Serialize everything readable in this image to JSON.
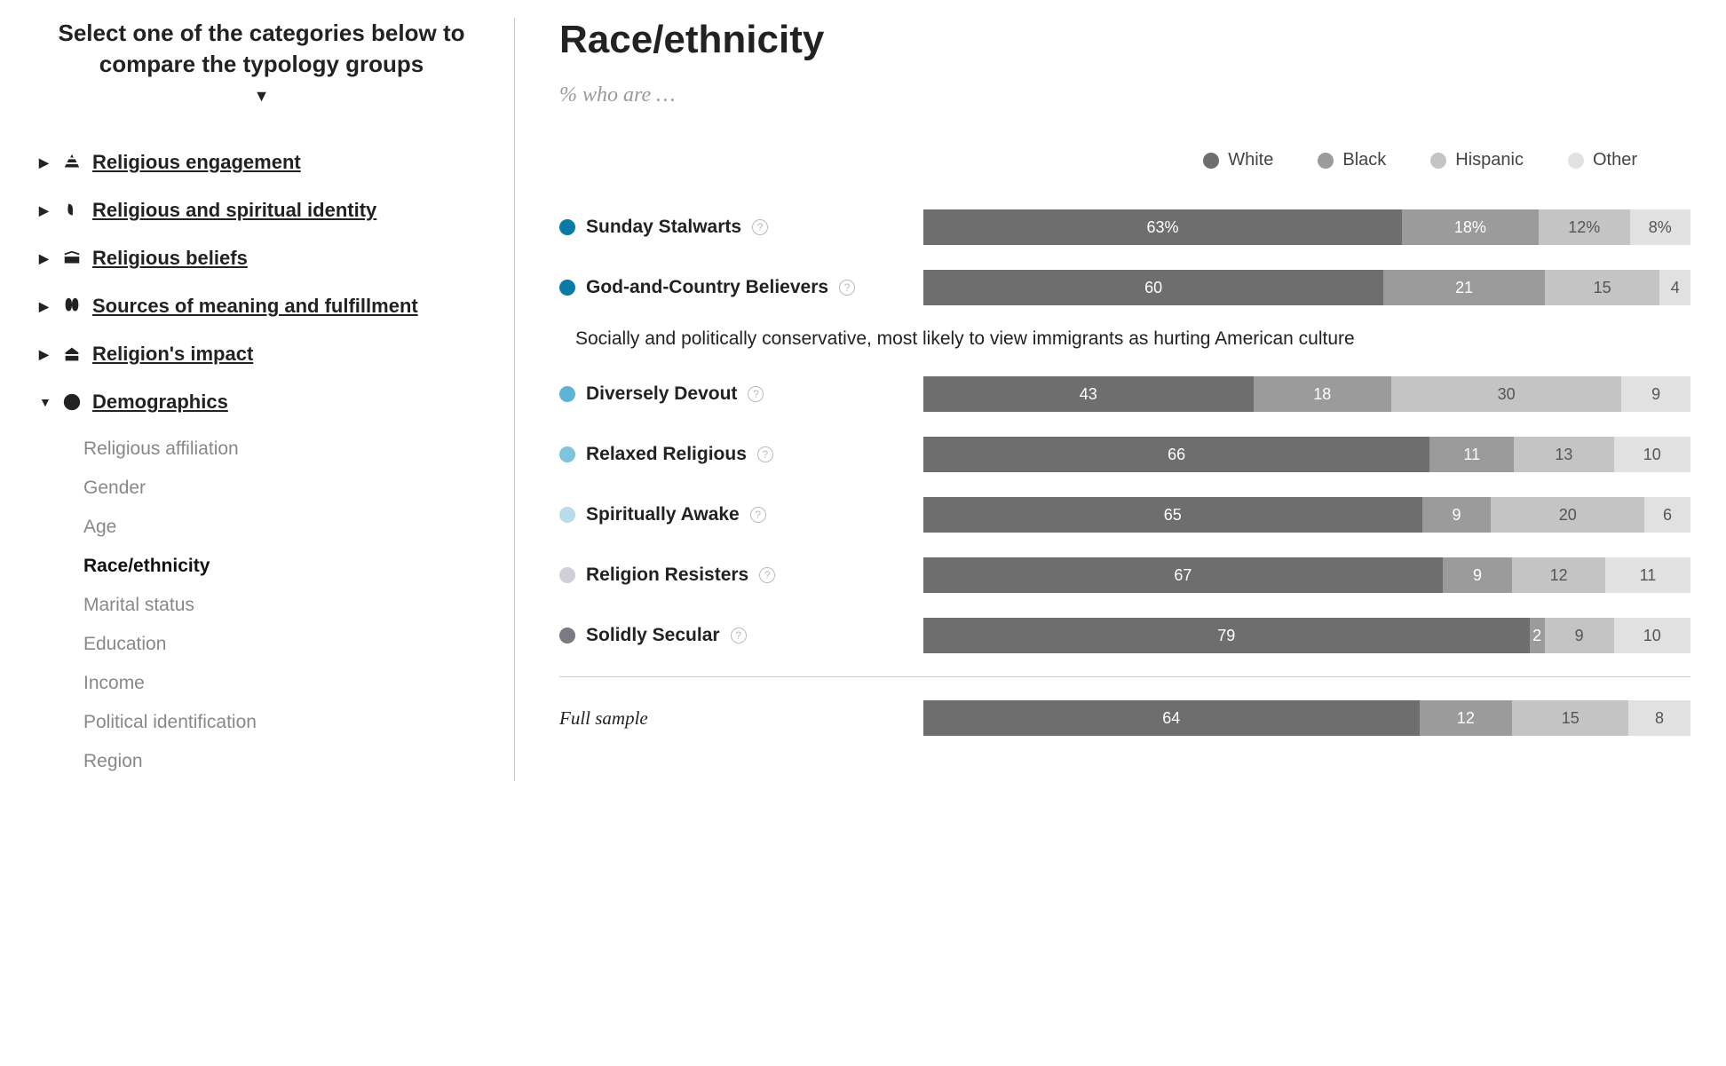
{
  "sidebar": {
    "header": "Select one of the categories below to compare the typology groups",
    "items": [
      {
        "label": "Religious engagement",
        "expanded": false
      },
      {
        "label": "Religious and spiritual identity",
        "expanded": false
      },
      {
        "label": "Religious beliefs",
        "expanded": false
      },
      {
        "label": "Sources of meaning and fulfillment",
        "expanded": false
      },
      {
        "label": "Religion's impact",
        "expanded": false
      },
      {
        "label": "Demographics",
        "expanded": true
      }
    ],
    "sub": [
      "Religious affiliation",
      "Gender",
      "Age",
      "Race/ethnicity",
      "Marital status",
      "Education",
      "Income",
      "Political identification",
      "Region"
    ],
    "sub_active": "Race/ethnicity"
  },
  "main": {
    "title": "Race/ethnicity",
    "subtitle": "% who are …",
    "tooltip": "Socially and politically conservative, most likely to view immigrants as hurting American culture",
    "full_sample_label": "Full sample"
  },
  "legend": [
    {
      "label": "White",
      "color": "#6e6e6e"
    },
    {
      "label": "Black",
      "color": "#9b9b9b"
    },
    {
      "label": "Hispanic",
      "color": "#c4c4c4"
    },
    {
      "label": "Other",
      "color": "#e1e1e1"
    }
  ],
  "groups": [
    {
      "name": "Sunday Stalwarts",
      "dot": "#0a7aa6"
    },
    {
      "name": "God-and-Country Believers",
      "dot": "#0a7aa6"
    },
    {
      "name": "Diversely Devout",
      "dot": "#5db4d4"
    },
    {
      "name": "Relaxed Religious",
      "dot": "#7fc4df"
    },
    {
      "name": "Spiritually Awake",
      "dot": "#b8dcea"
    },
    {
      "name": "Religion Resisters",
      "dot": "#cfcfd6"
    },
    {
      "name": "Solidly Secular",
      "dot": "#7a7a85"
    }
  ],
  "chart_data": {
    "type": "bar",
    "title": "Race/ethnicity",
    "subtitle": "% who are …",
    "xlabel": "",
    "ylabel": "",
    "stacked": true,
    "orientation": "horizontal",
    "unit": "%",
    "categories": [
      "Sunday Stalwarts",
      "God-and-Country Believers",
      "Diversely Devout",
      "Relaxed Religious",
      "Spiritually Awake",
      "Religion Resisters",
      "Solidly Secular",
      "Full sample"
    ],
    "series": [
      {
        "name": "White",
        "color": "#6e6e6e",
        "values": [
          63,
          60,
          43,
          66,
          65,
          67,
          79,
          64
        ]
      },
      {
        "name": "Black",
        "color": "#9b9b9b",
        "values": [
          18,
          21,
          18,
          11,
          9,
          9,
          2,
          12
        ]
      },
      {
        "name": "Hispanic",
        "color": "#c4c4c4",
        "values": [
          12,
          15,
          30,
          13,
          20,
          12,
          9,
          15
        ]
      },
      {
        "name": "Other",
        "color": "#e1e1e1",
        "values": [
          8,
          4,
          9,
          10,
          6,
          11,
          10,
          8
        ]
      }
    ]
  }
}
